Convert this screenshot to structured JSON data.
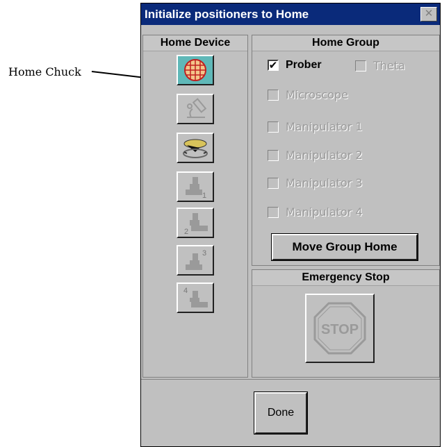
{
  "callout": {
    "label": "Home Chuck"
  },
  "dialog": {
    "title": "Initialize positioners to Home",
    "close_glyph": "✕",
    "home_device": {
      "header": "Home Device",
      "buttons": [
        {
          "icon": "chuck-icon",
          "active": true,
          "enabled": true
        },
        {
          "icon": "microscope-icon",
          "active": false,
          "enabled": false
        },
        {
          "icon": "prober-platen-icon",
          "active": false,
          "enabled": true
        },
        {
          "icon": "manipulator-1-icon",
          "number": "1",
          "enabled": false
        },
        {
          "icon": "manipulator-2-icon",
          "number": "2",
          "enabled": false
        },
        {
          "icon": "manipulator-3-icon",
          "number": "3",
          "enabled": false
        },
        {
          "icon": "manipulator-4-icon",
          "number": "4",
          "enabled": false
        }
      ]
    },
    "home_group": {
      "header": "Home Group",
      "prober": {
        "label": "Prober",
        "checked": true,
        "check_glyph": "✔"
      },
      "theta": {
        "label": "Theta",
        "checked": false
      },
      "microscope": {
        "label": "Microscope",
        "checked": false
      },
      "manipulators": [
        {
          "label": "Manipulator 1"
        },
        {
          "label": "Manipulator 2"
        },
        {
          "label": "Manipulator 3"
        },
        {
          "label": "Manipulator 4"
        }
      ],
      "move_button": "Move Group Home"
    },
    "emergency": {
      "header": "Emergency Stop",
      "stop_text": "STOP"
    },
    "done_button": "Done"
  }
}
